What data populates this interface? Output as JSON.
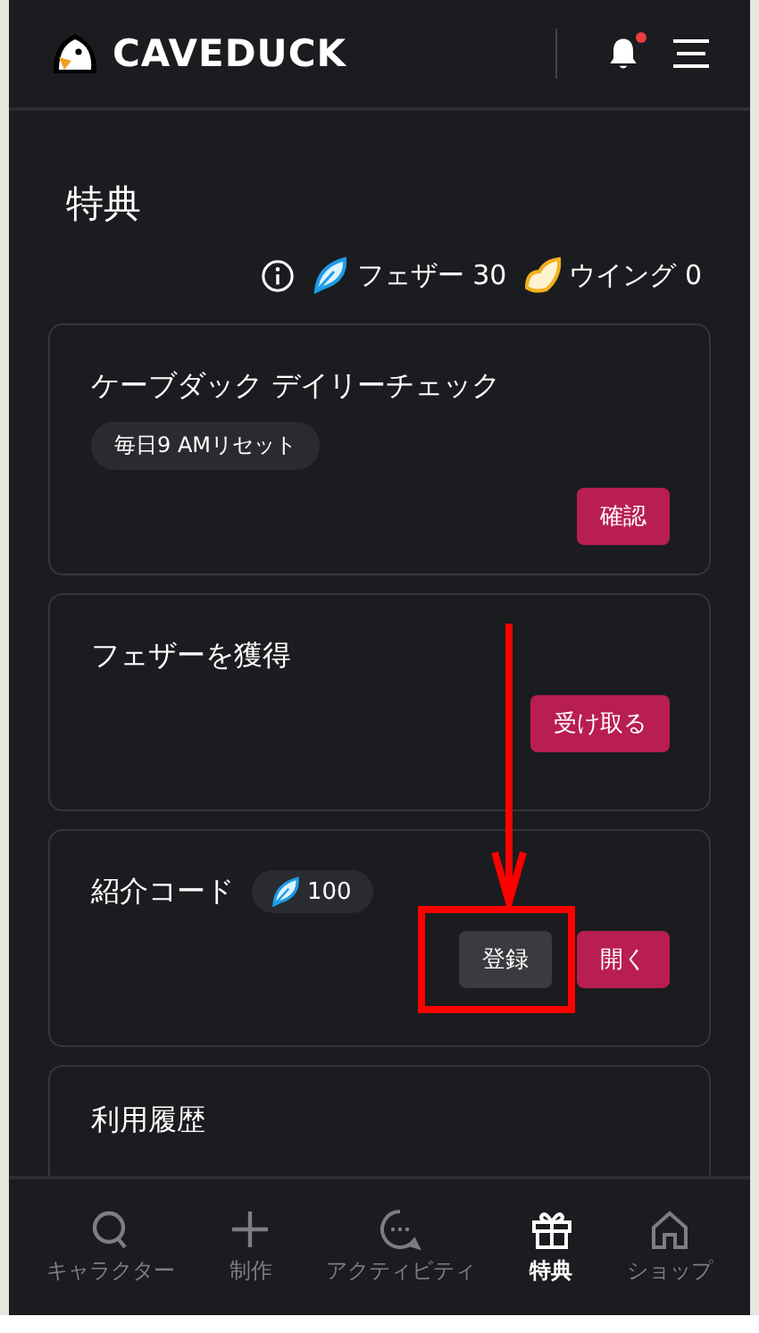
{
  "header": {
    "logo": "CAVEDUCK",
    "notification_dot": true
  },
  "page": {
    "title": "特典"
  },
  "balances": [
    {
      "kind": "feather",
      "label": "フェザー 30"
    },
    {
      "kind": "wing",
      "label": "ウイング 0"
    }
  ],
  "cards": [
    {
      "title": "ケーブダック デイリーチェック",
      "badge": "毎日9 AMリセット",
      "buttons": [
        {
          "label": "確認",
          "kind": "primary",
          "highlighted": false
        }
      ]
    },
    {
      "title": "フェザーを獲得",
      "buttons": [
        {
          "label": "受け取る",
          "kind": "primary",
          "highlighted": false
        }
      ]
    },
    {
      "title": "紹介コード",
      "reward": "100",
      "buttons": [
        {
          "label": "登録",
          "kind": "secondary",
          "highlighted": true
        },
        {
          "label": "開く",
          "kind": "primary",
          "highlighted": false
        }
      ]
    },
    {
      "title": "利用履歴"
    }
  ],
  "nav": [
    {
      "kind": "search",
      "label": "キャラクター",
      "selected": false
    },
    {
      "kind": "plus",
      "label": "制作",
      "selected": false
    },
    {
      "kind": "chat",
      "label": "アクティビティ",
      "selected": false
    },
    {
      "kind": "gift",
      "label": "特典",
      "selected": true
    },
    {
      "kind": "home",
      "label": "ショップ",
      "selected": false
    }
  ]
}
